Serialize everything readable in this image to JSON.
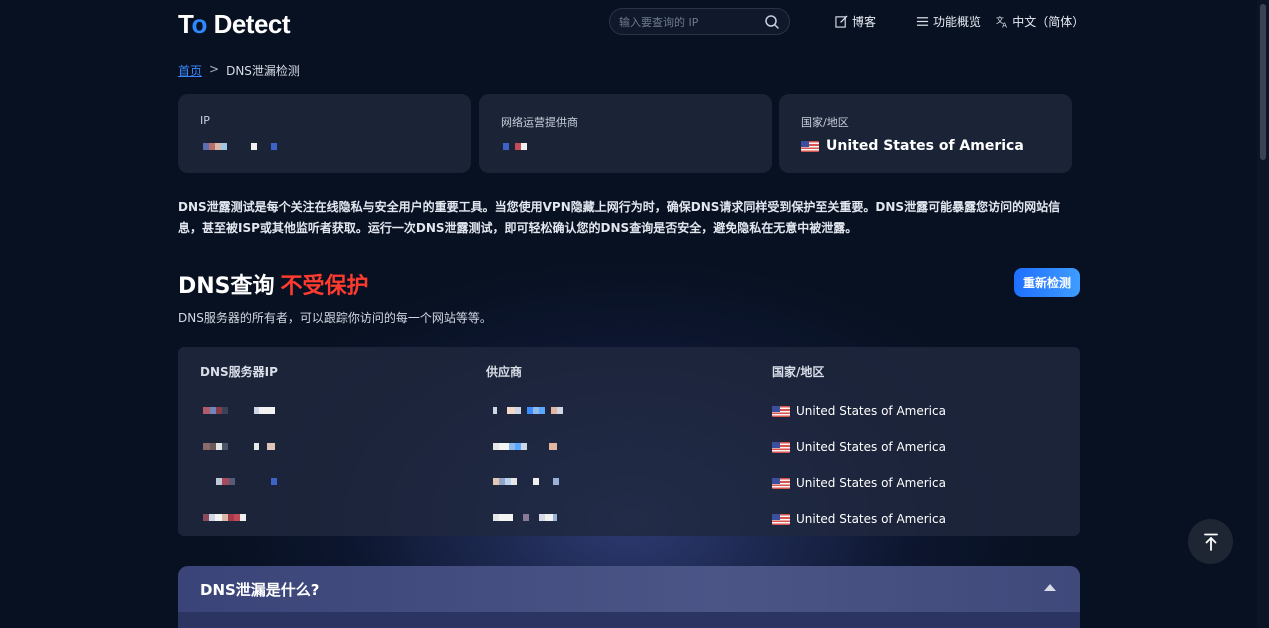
{
  "header": {
    "logo_main": "T",
    "logo_o": "o",
    "logo_rest": " Detect",
    "search_placeholder": "输入要查询的 IP",
    "nav_blog": "博客",
    "nav_features": "功能概览",
    "nav_language": "中文（简体）"
  },
  "breadcrumb": {
    "home": "首页",
    "separator": ">",
    "current": "DNS泄漏检测"
  },
  "cards": {
    "ip_label": "IP",
    "isp_label": "网络运营提供商",
    "country_label": "国家/地区",
    "country_value": "United States of America"
  },
  "intro": "DNS泄露测试是每个关注在线隐私与安全用户的重要工具。当您使用VPN隐藏上网行为时，确保DNS请求同样受到保护至关重要。DNS泄露可能暴露您访问的网站信息，甚至被ISP或其他监听者获取。运行一次DNS泄露测试，即可轻松确认您的DNS查询是否安全，避免隐私在无意中被泄露。",
  "dns": {
    "title": "DNS查询",
    "status": "不受保护",
    "status_color": "#ff3b30",
    "subtitle": "DNS服务器的所有者，可以跟踪你访问的每一个网站等等。",
    "recheck_button": "重新检测"
  },
  "table": {
    "headers": [
      "DNS服务器IP",
      "供应商",
      "国家/地区"
    ],
    "rows": [
      {
        "country": "United States of America"
      },
      {
        "country": "United States of America"
      },
      {
        "country": "United States of America"
      },
      {
        "country": "United States of America"
      }
    ]
  },
  "faq": {
    "question": "DNS泄漏是什么?"
  },
  "colors": {
    "accent": "#2f88ff",
    "background": "#081121",
    "card": "#1b2336"
  },
  "icons": [
    "search-icon",
    "edit-icon",
    "menu-icon",
    "translate-icon",
    "us-flag-icon",
    "caret-up-icon",
    "arrow-to-top-icon"
  ]
}
